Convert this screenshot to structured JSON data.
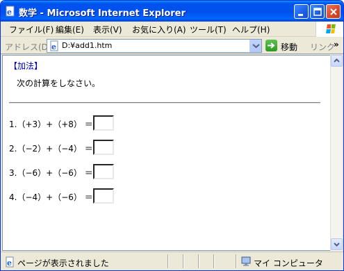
{
  "window": {
    "title": "数学 - Microsoft Internet Explorer"
  },
  "menu": {
    "items": [
      "ファイル(F)",
      "編集(E)",
      "表示(V)",
      "お気に入り(A)",
      "ツール(T)",
      "ヘルプ(H)"
    ]
  },
  "address": {
    "label": "アドレス(D)",
    "value": "D:¥add1.htm",
    "go_label": "移動",
    "links_label": "リンク",
    "more": "»"
  },
  "content": {
    "title": "【加法】",
    "instruction": "次の計算をしなさい。",
    "problems": [
      {
        "text": "1.（+3）+（+8） ＝",
        "answer": ""
      },
      {
        "text": "2.（−2）+（−4） ＝",
        "answer": ""
      },
      {
        "text": "3.（−6）+（−6） ＝",
        "answer": ""
      },
      {
        "text": "4.（−4）+（−6） ＝",
        "answer": ""
      }
    ]
  },
  "status": {
    "text": "ページが表示されました",
    "zone": "マイ コンピュータ"
  },
  "colors": {
    "titlebar": "#0053ee",
    "heading": "#0000cc"
  }
}
